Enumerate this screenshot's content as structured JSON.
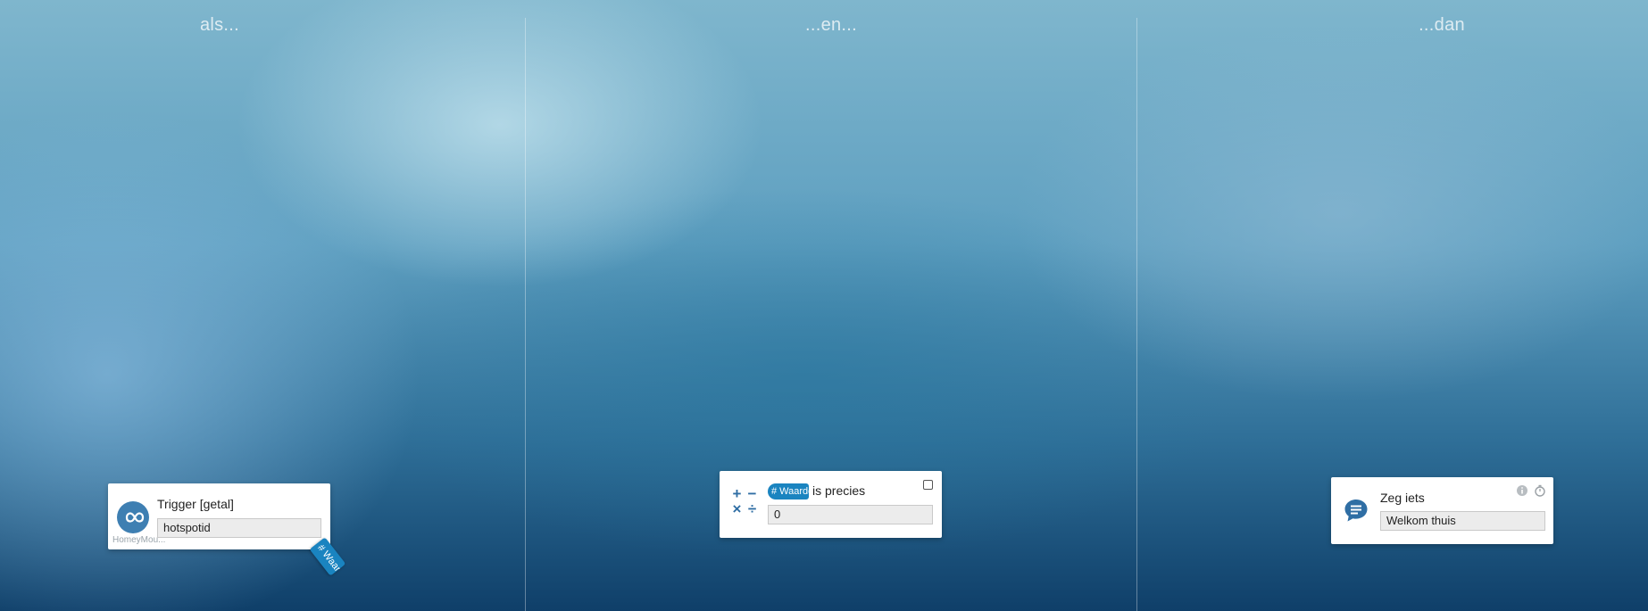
{
  "columns": {
    "when": {
      "heading": "als..."
    },
    "and": {
      "heading": "...en..."
    },
    "then": {
      "heading": "...dan"
    }
  },
  "trigger_card": {
    "title": "Trigger [getal]",
    "input_value": "hotspotid",
    "app_label": "HomeyMou...",
    "app_icon": "infinity-icon",
    "token_tag": "# Waar"
  },
  "condition_card": {
    "token_chip": "# Waarde",
    "text": "is precies",
    "input_value": "0",
    "operators": [
      "+",
      "−",
      "×",
      "÷"
    ],
    "icon": "calculator-icon"
  },
  "action_card": {
    "title": "Zeg iets",
    "input_value": "Welkom thuis",
    "icon": "speech-bubble-icon",
    "info_icon": "info-icon",
    "delay_icon": "stopwatch-icon"
  },
  "colors": {
    "accent": "#1a84c0",
    "icon_blue": "#2f6ea4",
    "app_icon_bg": "#3e7fb2"
  }
}
